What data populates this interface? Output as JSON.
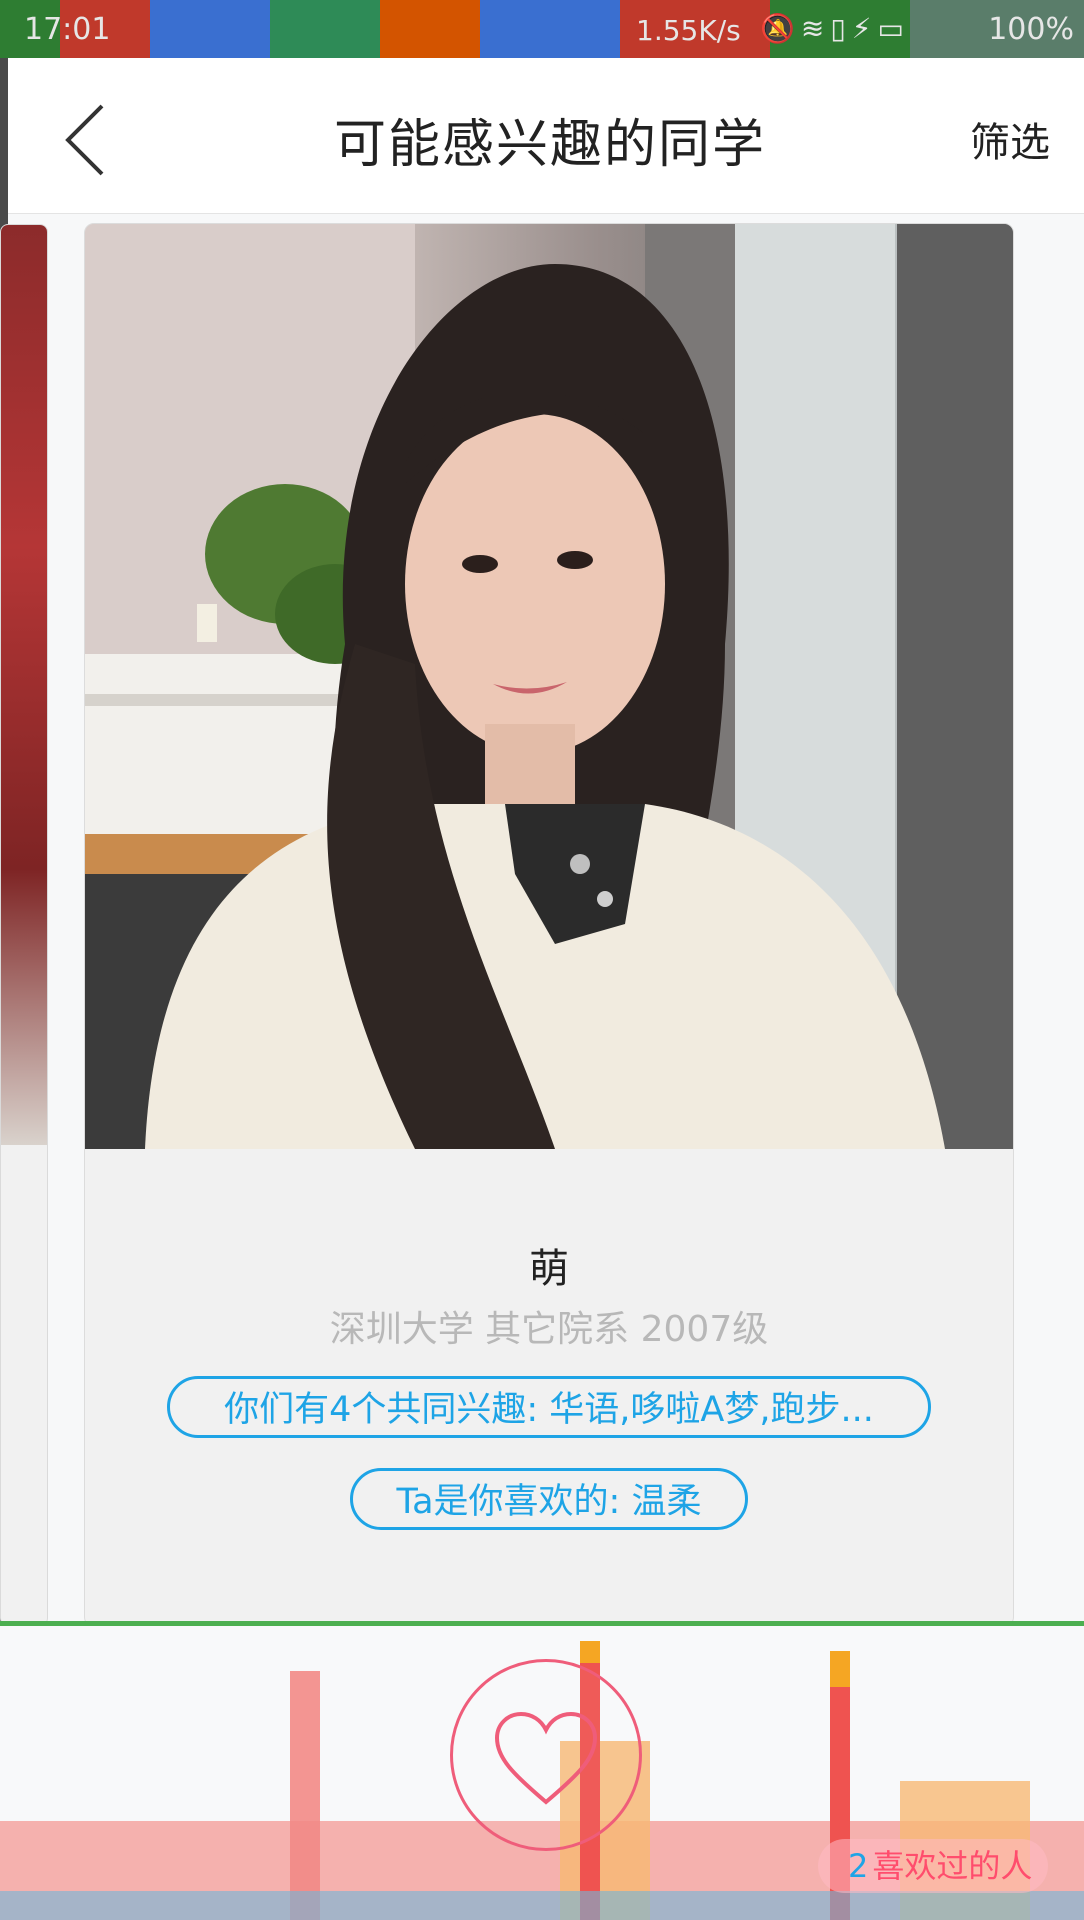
{
  "status_bar": {
    "time": "17:01",
    "net_speed": "1.55K/s",
    "battery": "100%"
  },
  "header": {
    "title": "可能感兴趣的同学",
    "filter_label": "筛选",
    "back_icon": "chevron-left-icon"
  },
  "card": {
    "name": "萌",
    "school": "深圳大学 其它院系 2007级",
    "tags": [
      "你们有4个共同兴趣: 华语,哆啦A梦,跑步...",
      "Ta是你喜欢的: 温柔"
    ]
  },
  "bottom": {
    "like_icon": "heart-icon",
    "liked_count": "2",
    "liked_label": "喜欢过的人"
  },
  "colors": {
    "accent": "#1ea4e6",
    "like": "#ef5d7a"
  }
}
